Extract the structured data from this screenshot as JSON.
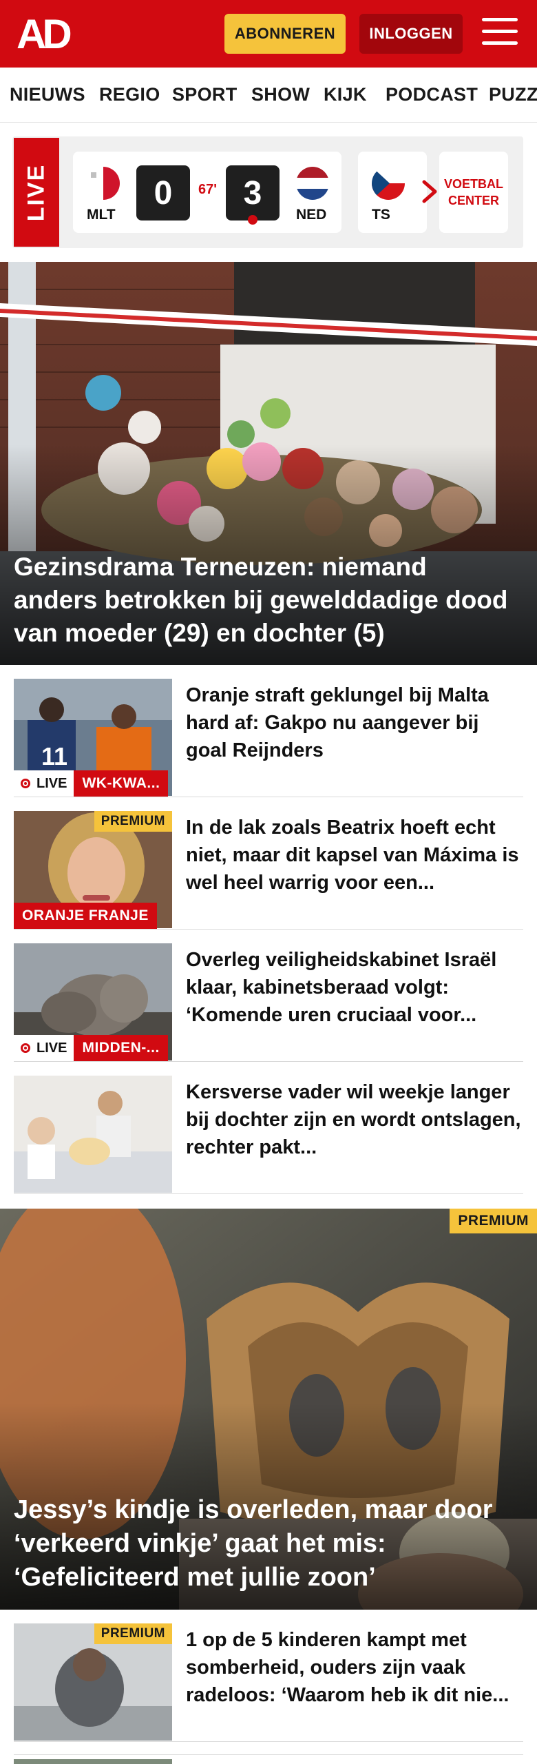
{
  "header": {
    "logo_text": "AD",
    "subscribe_label": "ABONNEREN",
    "login_label": "INLOGGEN",
    "brand_color": "#d10a11",
    "subscribe_color": "#f5c33b"
  },
  "nav": {
    "items": [
      "NIEUWS",
      "REGIO",
      "SPORT",
      "SHOW",
      "KIJK",
      "PODCAST",
      "PUZZ"
    ]
  },
  "live": {
    "badge": "LIVE",
    "match": {
      "home_code": "MLT",
      "home_score": "0",
      "away_code": "NED",
      "away_score": "3",
      "minute": "67'"
    },
    "next_match_code": "TS",
    "voetbal_center": [
      "VOETBAL",
      "CENTER"
    ]
  },
  "hero": {
    "title": "Gezinsdrama Terneuzen: niemand anders betrokken bij gewelddadige dood van moeder (29) en dochter (5)"
  },
  "articles": [
    {
      "title": "Oranje straft geklungel bij Malta hard af: Gakpo nu aangever bij goal Reijnders",
      "live_label": "LIVE",
      "category": "WK-KWA..."
    },
    {
      "title": "In de lak zoals Beatrix hoeft echt niet, maar dit kapsel van Máxima is wel heel warrig voor een...",
      "premium": "PREMIUM",
      "category": "ORANJE FRANJE"
    },
    {
      "title": "Overleg veiligheidskabinet Israël klaar, kabinetsberaad volgt: ‘Komende uren cruciaal voor...",
      "live_label": "LIVE",
      "category": "MIDDEN-..."
    },
    {
      "title": "Kersverse vader wil weekje langer bij dochter zijn en wordt ontslagen, rechter pakt..."
    }
  ],
  "hero2": {
    "premium": "PREMIUM",
    "title": "Jessy’s kindje is overleden, maar door ‘verkeerd vinkje’ gaat het mis: ‘Gefeliciteerd met jullie zoon’"
  },
  "article5": {
    "premium": "PREMIUM",
    "title": "1 op de 5 kinderen kampt met somberheid, ouders zijn vaak radeloos: ‘Waarom heb ik dit nie..."
  }
}
